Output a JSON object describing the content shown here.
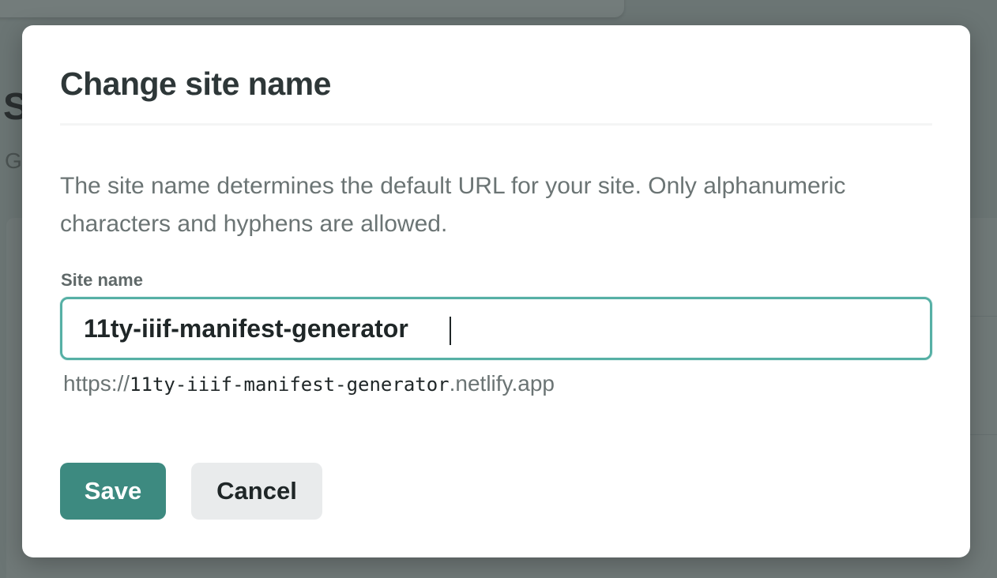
{
  "background": {
    "heading_glyph": "S",
    "sub_glyph": "G"
  },
  "dialog": {
    "title": "Change site name",
    "description": "The site name determines the default URL for your site. Only alphanumeric characters and hyphens are allowed.",
    "field": {
      "label": "Site name",
      "value": "11ty-iiif-manifest-generator"
    },
    "url_preview": {
      "prefix": "https://",
      "site": "11ty-iiif-manifest-generator",
      "suffix": ".netlify.app"
    },
    "buttons": {
      "save_label": "Save",
      "cancel_label": "Cancel"
    }
  },
  "colors": {
    "overlay": "#6b7574",
    "accent": "#3d8a80",
    "focus_border": "#56b0a5",
    "cancel_bg": "#e9ebec"
  }
}
